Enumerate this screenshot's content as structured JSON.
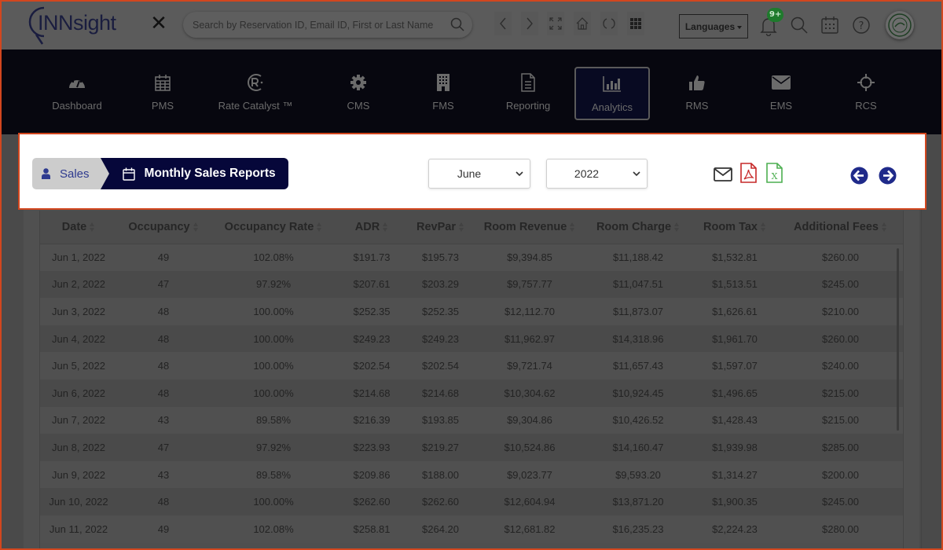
{
  "header": {
    "logo_text": "INNsight",
    "search_placeholder": "Search by Reservation ID, Email ID, First or Last Name",
    "languages_label": "Languages",
    "notification_badge": "9+",
    "nav_icons": [
      "chevron-left-icon",
      "chevron-right-icon",
      "expand-icon",
      "home-icon",
      "refresh-icon",
      "grid-icon"
    ],
    "right_icons": [
      "bell-icon",
      "search-icon",
      "calendar-icon",
      "help-icon",
      "avatar"
    ]
  },
  "modules": [
    {
      "label": "Dashboard",
      "icon": "gauge-icon"
    },
    {
      "label": "PMS",
      "icon": "calendar-icon"
    },
    {
      "label": "Rate Catalyst ™",
      "icon": "rate-catalyst-icon"
    },
    {
      "label": "CMS",
      "icon": "gear-icon"
    },
    {
      "label": "FMS",
      "icon": "building-icon"
    },
    {
      "label": "Reporting",
      "icon": "document-icon"
    },
    {
      "label": "Analytics",
      "icon": "bar-chart-icon",
      "active": true
    },
    {
      "label": "RMS",
      "icon": "thumbs-up-icon"
    },
    {
      "label": "EMS",
      "icon": "envelope-icon"
    },
    {
      "label": "RCS",
      "icon": "crosshair-icon"
    }
  ],
  "toolbar": {
    "breadcrumb": [
      {
        "label": "Sales",
        "icon": "user-icon"
      },
      {
        "label": "Monthly Sales Reports",
        "icon": "calendar-icon"
      }
    ],
    "month_select": "June",
    "year_select": "2022",
    "actions": [
      "email-icon",
      "pdf-icon",
      "excel-icon"
    ],
    "colors": {
      "accent": "#06073a",
      "pdf": "#c62828",
      "excel": "#4caf50",
      "nav_arrow": "#1f2a8a"
    }
  },
  "table": {
    "columns": [
      "Date",
      "Occupancy",
      "Occupancy Rate",
      "ADR",
      "RevPar",
      "Room Revenue",
      "Room Charge",
      "Room Tax",
      "Additional Fees"
    ],
    "rows": [
      [
        "Jun 1, 2022",
        "49",
        "102.08%",
        "$191.73",
        "$195.73",
        "$9,394.85",
        "$11,188.42",
        "$1,532.81",
        "$260.00"
      ],
      [
        "Jun 2, 2022",
        "47",
        "97.92%",
        "$207.61",
        "$203.29",
        "$9,757.77",
        "$11,047.51",
        "$1,513.51",
        "$245.00"
      ],
      [
        "Jun 3, 2022",
        "48",
        "100.00%",
        "$252.35",
        "$252.35",
        "$12,112.70",
        "$11,873.07",
        "$1,626.61",
        "$210.00"
      ],
      [
        "Jun 4, 2022",
        "48",
        "100.00%",
        "$249.23",
        "$249.23",
        "$11,962.97",
        "$14,318.96",
        "$1,961.70",
        "$260.00"
      ],
      [
        "Jun 5, 2022",
        "48",
        "100.00%",
        "$202.54",
        "$202.54",
        "$9,721.74",
        "$11,657.43",
        "$1,597.07",
        "$240.00"
      ],
      [
        "Jun 6, 2022",
        "48",
        "100.00%",
        "$214.68",
        "$214.68",
        "$10,304.62",
        "$10,924.45",
        "$1,496.65",
        "$215.00"
      ],
      [
        "Jun 7, 2022",
        "43",
        "89.58%",
        "$216.39",
        "$193.85",
        "$9,304.86",
        "$10,426.52",
        "$1,428.43",
        "$215.00"
      ],
      [
        "Jun 8, 2022",
        "47",
        "97.92%",
        "$223.93",
        "$219.27",
        "$10,524.86",
        "$14,160.47",
        "$1,939.98",
        "$285.00"
      ],
      [
        "Jun 9, 2022",
        "43",
        "89.58%",
        "$209.86",
        "$188.00",
        "$9,023.77",
        "$9,593.20",
        "$1,314.27",
        "$200.00"
      ],
      [
        "Jun 10, 2022",
        "48",
        "100.00%",
        "$262.60",
        "$262.60",
        "$12,604.94",
        "$13,871.20",
        "$1,900.35",
        "$245.00"
      ],
      [
        "Jun 11, 2022",
        "49",
        "102.08%",
        "$258.81",
        "$264.20",
        "$12,681.82",
        "$16,235.23",
        "$2,224.23",
        "$280.00"
      ]
    ]
  }
}
